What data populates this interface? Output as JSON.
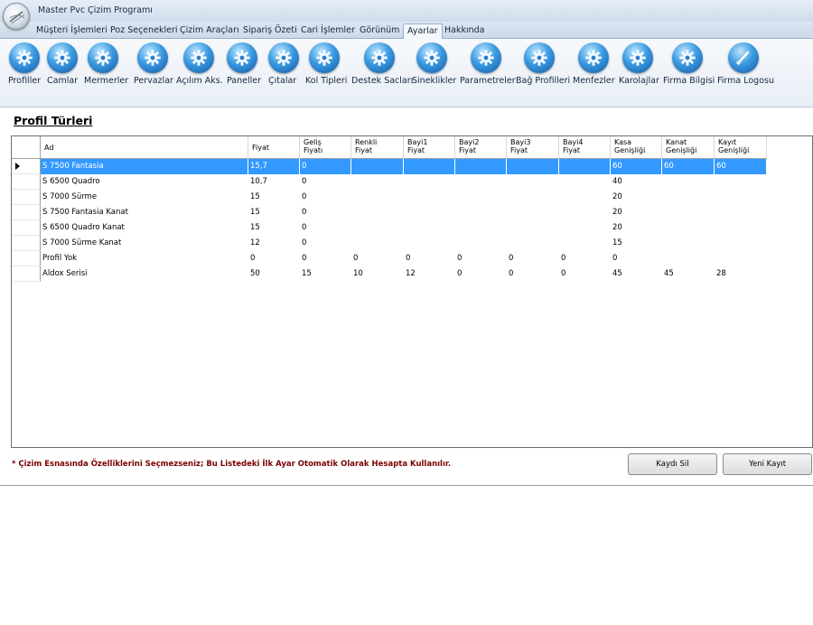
{
  "window": {
    "title": "Master Pvc Çizim Programı"
  },
  "tabs": [
    {
      "label": "Müşteri İşlemleri",
      "active": false
    },
    {
      "label": "Poz Seçenekleri",
      "active": false
    },
    {
      "label": "Çizim Araçları",
      "active": false
    },
    {
      "label": "Sipariş Özeti",
      "active": false
    },
    {
      "label": "Cari İşlemler",
      "active": false
    },
    {
      "label": "Görünüm",
      "active": false
    },
    {
      "label": "Ayarlar",
      "active": true
    },
    {
      "label": "Hakkında",
      "active": false
    }
  ],
  "ribbon": {
    "buttons": [
      {
        "label": "Profiller",
        "icon": "gear-icon"
      },
      {
        "label": "Camlar",
        "icon": "gear-icon"
      },
      {
        "label": "Mermerler",
        "icon": "gear-icon"
      },
      {
        "label": "Pervazlar",
        "icon": "gear-icon"
      },
      {
        "label": "Açılım Aks.",
        "icon": "gear-icon"
      },
      {
        "label": "Paneller",
        "icon": "gear-icon"
      },
      {
        "label": "Çıtalar",
        "icon": "gear-icon"
      },
      {
        "label": "Kol Tipleri",
        "icon": "gear-icon"
      },
      {
        "label": "Destek Sacları",
        "icon": "gear-icon"
      },
      {
        "label": "Sineklikler",
        "icon": "gear-icon"
      },
      {
        "label": "Parametreler",
        "icon": "gear-icon"
      },
      {
        "label": "Bağ Profilleri",
        "icon": "gear-icon"
      },
      {
        "label": "Menfezler",
        "icon": "gear-icon"
      },
      {
        "label": "Karolajlar",
        "icon": "gear-icon"
      },
      {
        "label": "Firma Bilgisi",
        "icon": "gear-icon"
      },
      {
        "label": "Firma Logosu",
        "icon": "brush-icon"
      }
    ]
  },
  "page": {
    "heading": "Profil Türleri"
  },
  "grid": {
    "columns": [
      {
        "key": "ad",
        "line1": "Ad",
        "line2": ""
      },
      {
        "key": "fiyat",
        "line1": "Fiyat",
        "line2": ""
      },
      {
        "key": "gelis",
        "line1": "Geliş",
        "line2": "Fiyatı"
      },
      {
        "key": "renkli",
        "line1": "Renkli",
        "line2": "Fiyat"
      },
      {
        "key": "bayi1",
        "line1": "Bayi1",
        "line2": "Fiyat"
      },
      {
        "key": "bayi2",
        "line1": "Bayi2",
        "line2": "Fiyat"
      },
      {
        "key": "bayi3",
        "line1": "Bayi3",
        "line2": "Fiyat"
      },
      {
        "key": "bayi4",
        "line1": "Bayi4",
        "line2": "Fiyat"
      },
      {
        "key": "kasa",
        "line1": "Kasa",
        "line2": "Genişliği"
      },
      {
        "key": "kanat",
        "line1": "Kanat",
        "line2": "Genişliği"
      },
      {
        "key": "kayit",
        "line1": "Kayıt",
        "line2": "Genişliği"
      }
    ],
    "selected_row": 0,
    "rows": [
      [
        "S 7500 Fantasia",
        "15,7",
        "0",
        "",
        "",
        "",
        "",
        "",
        "60",
        "60",
        "60"
      ],
      [
        "S 6500 Quadro",
        "10,7",
        "0",
        "",
        "",
        "",
        "",
        "",
        "40",
        "",
        ""
      ],
      [
        "S 7000 Sürme",
        "15",
        "0",
        "",
        "",
        "",
        "",
        "",
        "20",
        "",
        ""
      ],
      [
        "S 7500 Fantasia Kanat",
        "15",
        "0",
        "",
        "",
        "",
        "",
        "",
        "20",
        "",
        ""
      ],
      [
        "S 6500 Quadro Kanat",
        "15",
        "0",
        "",
        "",
        "",
        "",
        "",
        "20",
        "",
        ""
      ],
      [
        "S 7000 Sürme Kanat",
        "12",
        "0",
        "",
        "",
        "",
        "",
        "",
        "15",
        "",
        ""
      ],
      [
        "Profil Yok",
        "0",
        "0",
        "0",
        "0",
        "0",
        "0",
        "0",
        "0",
        "",
        ""
      ],
      [
        "Aldox Serisi",
        "50",
        "15",
        "10",
        "12",
        "0",
        "0",
        "0",
        "45",
        "45",
        "28"
      ]
    ]
  },
  "footer": {
    "note": "* Çizim Esnasında Özelliklerini Seçmezseniz; Bu Listedeki İlk Ayar Otomatik Olarak Hesapta Kullanılır.",
    "delete_label": "Kaydı Sil",
    "new_label": "Yeni Kayıt"
  }
}
